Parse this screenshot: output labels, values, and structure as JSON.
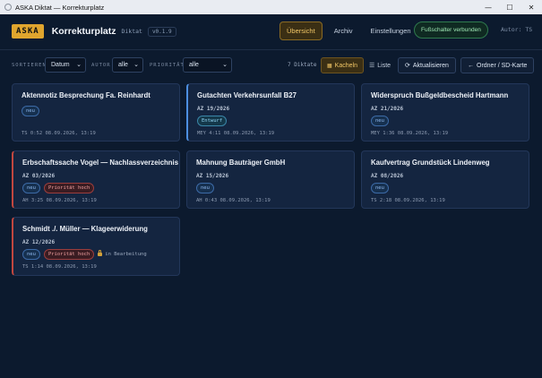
{
  "window": {
    "title": "ASKA Diktat — Korrekturplatz",
    "minimize": "—",
    "maximize": "☐",
    "close": "✕"
  },
  "header": {
    "logo": "ASKA",
    "title": "Korrekturplatz",
    "subtitle": "Diktat",
    "version": "v0.1.9",
    "nav": [
      "Übersicht",
      "Archiv",
      "Einstellungen"
    ],
    "status": "Fußschalter verbunden",
    "author": "Autor: TS"
  },
  "toolbar": {
    "sort_label": "SORTIEREN",
    "sort_value": "Datum",
    "author_label": "AUTOR",
    "author_value": "alle",
    "priority_label": "PRIORITÄT",
    "priority_value": "alle",
    "count": "7 Diktate",
    "view_tiles": "Kacheln",
    "view_list": "Liste",
    "refresh": "Aktualisieren",
    "folder": "Ordner / SD-Karte"
  },
  "cards": [
    {
      "title": "Aktennotiz Besprechung Fa. Reinhardt",
      "az": "",
      "badges": [
        "neu"
      ],
      "meta": "TS  0:52  08.09.2026, 13:19"
    },
    {
      "title": "Gutachten Verkehrsunfall B27",
      "az": "AZ 19/2026",
      "badges": [
        "Entwurf"
      ],
      "meta": "MEY  4:11  08.09.2026, 13:19"
    },
    {
      "title": "Widerspruch Bußgeldbescheid Hartmann",
      "az": "AZ 21/2026",
      "badges": [
        "neu"
      ],
      "meta": "MEY  1:36  08.09.2026, 13:19"
    },
    {
      "title": "Erbschaftssache Vogel — Nachlassverzeichnis",
      "az": "AZ 03/2026",
      "badges": [
        "neu",
        "Priorität hoch"
      ],
      "meta": "AH  3:25  08.09.2026, 13:19"
    },
    {
      "title": "Mahnung Bauträger GmbH",
      "az": "AZ 15/2026",
      "badges": [
        "neu"
      ],
      "meta": "AH  0:43  08.09.2026, 13:19"
    },
    {
      "title": "Kaufvertrag Grundstück Lindenweg",
      "az": "AZ 08/2026",
      "badges": [
        "neu"
      ],
      "meta": "TS  2:18  08.09.2026, 13:19"
    },
    {
      "title": "Schmidt ./. Müller — Klageerwiderung",
      "az": "AZ 12/2026",
      "badges": [
        "neu",
        "Priorität hoch"
      ],
      "lock": "in Bearbeitung",
      "meta": "TS  1:14  08.09.2026, 13:19"
    }
  ]
}
